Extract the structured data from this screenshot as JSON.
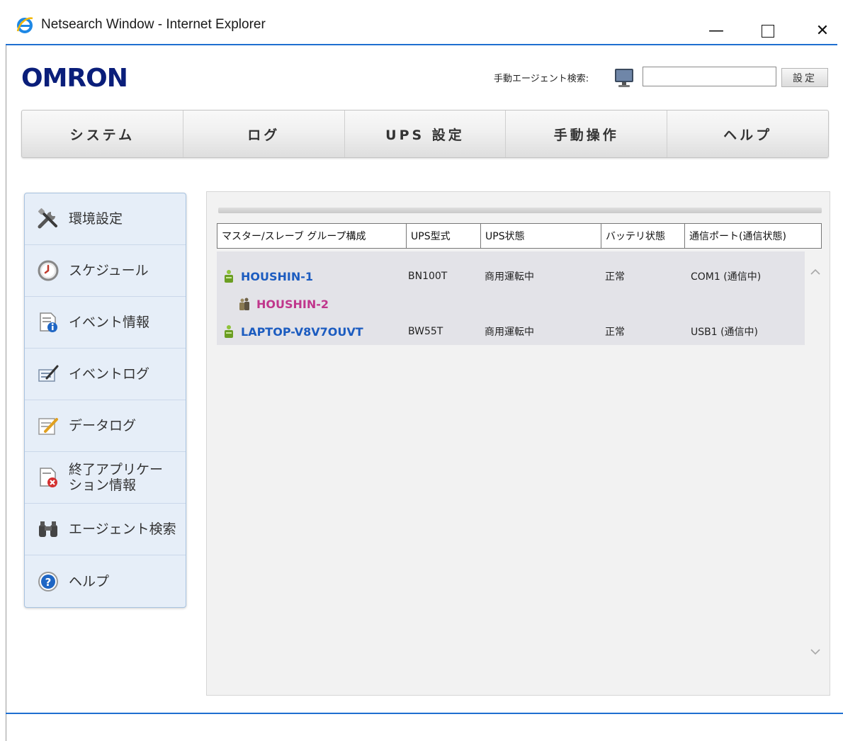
{
  "window": {
    "title": "Netsearch Window - Internet Explorer",
    "minimize": "—",
    "close": "✕"
  },
  "header": {
    "logo": "OMRON",
    "agent_search_label": "手動エージェント検索:",
    "agent_search_value": "",
    "set_button": "設定"
  },
  "topnav": [
    "システム",
    "ログ",
    "UPS 設定",
    "手動操作",
    "ヘルプ"
  ],
  "sidebar": [
    {
      "label": "環境設定",
      "icon": "tools-icon"
    },
    {
      "label": "スケジュール",
      "icon": "clock-icon"
    },
    {
      "label": "イベント情報",
      "icon": "event-info-icon"
    },
    {
      "label": "イベントログ",
      "icon": "event-log-icon"
    },
    {
      "label": "データログ",
      "icon": "data-log-icon"
    },
    {
      "label": "終了アプリケーション情報",
      "line1": "終了アプリケー",
      "line2": "ション情報",
      "icon": "shutdown-app-icon"
    },
    {
      "label": "エージェント検索",
      "icon": "binoculars-icon"
    },
    {
      "label": "ヘルプ",
      "icon": "help-icon"
    }
  ],
  "table": {
    "headers": [
      "マスター/スレーブ グループ構成",
      "UPS型式",
      "UPS状態",
      "バッテリ状態",
      "通信ポート(通信状態)"
    ],
    "rows": [
      {
        "name": "HOUSHIN-1",
        "role": "master",
        "model": "BN100T",
        "ups_status": "商用運転中",
        "battery": "正常",
        "port": "COM1 (通信中)"
      },
      {
        "name": "HOUSHIN-2",
        "role": "slave",
        "model": "",
        "ups_status": "",
        "battery": "",
        "port": ""
      },
      {
        "name": "LAPTOP-V8V7OUVT",
        "role": "master",
        "model": "BW55T",
        "ups_status": "商用運転中",
        "battery": "正常",
        "port": "USB1 (通信中)"
      }
    ]
  },
  "scrollbar": {
    "up": "^",
    "down": "v"
  },
  "colors": {
    "logo": "#0a1e7a",
    "master_link": "#1c5cc0",
    "slave_link": "#c0368c",
    "accent_rule": "#1f6fd0"
  }
}
